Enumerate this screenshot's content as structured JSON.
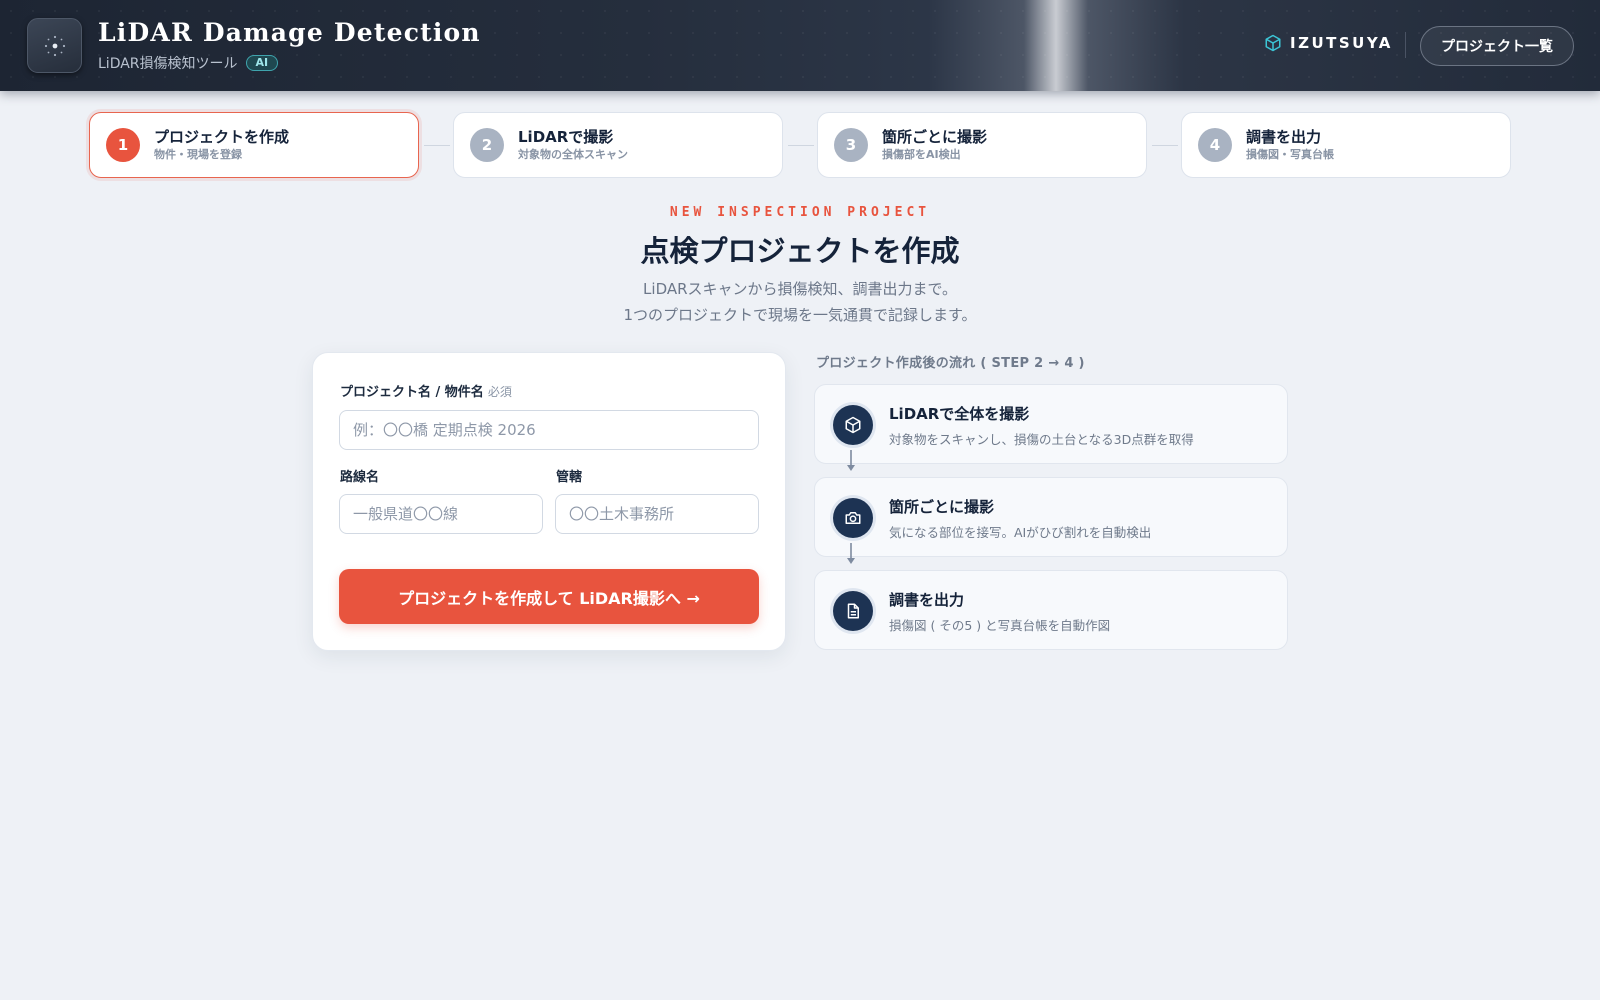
{
  "header": {
    "title": "LiDAR Damage Detection",
    "subtitle": "LiDAR損傷検知ツール",
    "ai_badge": "AI",
    "brand": "IZUTSUYA",
    "project_list_button": "プロジェクト一覧",
    "logo_icon": "scanner-dots-icon",
    "brand_icon": "cube-icon"
  },
  "steps": [
    {
      "number": "1",
      "title": "プロジェクトを作成",
      "desc": "物件・現場を登録",
      "active": true
    },
    {
      "number": "2",
      "title": "LiDARで撮影",
      "desc": "対象物の全体スキャン",
      "active": false
    },
    {
      "number": "3",
      "title": "箇所ごとに撮影",
      "desc": "損傷部をAI検出",
      "active": false
    },
    {
      "number": "4",
      "title": "調書を出力",
      "desc": "損傷図・写真台帳",
      "active": false
    }
  ],
  "hero": {
    "eyebrow": "NEW INSPECTION PROJECT",
    "title": "点検プロジェクトを作成",
    "desc_line1": "LiDARスキャンから損傷検知、調書出力まで。",
    "desc_line2": "1つのプロジェクトで現場を一気通貫で記録します。"
  },
  "form": {
    "project_name_label": "プロジェクト名 / 物件名",
    "required": "必須",
    "project_name_placeholder": "例：〇〇橋 定期点検 2026",
    "project_name_value": "",
    "route_label": "路線名",
    "route_placeholder": "一般県道〇〇線",
    "route_value": "",
    "office_label": "管轄",
    "office_placeholder": "〇〇土木事務所",
    "office_value": "",
    "submit_label": "プロジェクトを作成して LiDAR撮影へ →"
  },
  "flow": {
    "heading": "プロジェクト作成後の流れ ( STEP 2 → 4 )",
    "items": [
      {
        "title": "LiDARで全体を撮影",
        "desc": "対象物をスキャンし、損傷の土台となる3D点群を取得",
        "icon": "cube-icon"
      },
      {
        "title": "箇所ごとに撮影",
        "desc": "気になる部位を接写。AIがひび割れを自動検出",
        "icon": "camera-icon"
      },
      {
        "title": "調書を出力",
        "desc": "損傷図 ( その5 ) と写真台帳を自動作図",
        "icon": "document-icon"
      }
    ]
  },
  "colors": {
    "accent": "#e8543e",
    "navy": "#1d3353",
    "header_bg": "#222b3a",
    "page_bg": "#eef1f6",
    "brand_icon": "#3cc6d6"
  }
}
